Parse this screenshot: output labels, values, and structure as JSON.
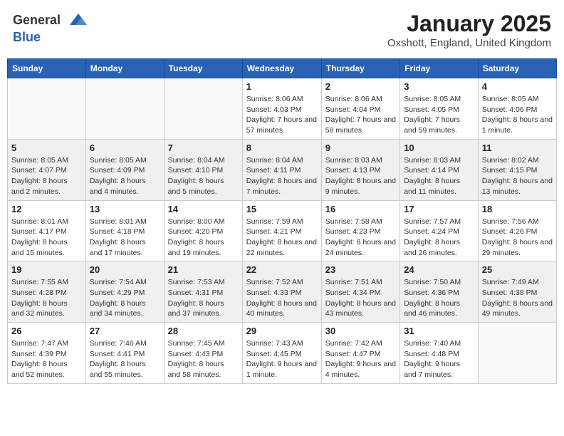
{
  "header": {
    "logo_general": "General",
    "logo_blue": "Blue",
    "month_title": "January 2025",
    "location": "Oxshott, England, United Kingdom"
  },
  "columns": [
    "Sunday",
    "Monday",
    "Tuesday",
    "Wednesday",
    "Thursday",
    "Friday",
    "Saturday"
  ],
  "weeks": [
    [
      {
        "day": "",
        "info": ""
      },
      {
        "day": "",
        "info": ""
      },
      {
        "day": "",
        "info": ""
      },
      {
        "day": "1",
        "info": "Sunrise: 8:06 AM\nSunset: 4:03 PM\nDaylight: 7 hours and 57 minutes."
      },
      {
        "day": "2",
        "info": "Sunrise: 8:06 AM\nSunset: 4:04 PM\nDaylight: 7 hours and 58 minutes."
      },
      {
        "day": "3",
        "info": "Sunrise: 8:05 AM\nSunset: 4:05 PM\nDaylight: 7 hours and 59 minutes."
      },
      {
        "day": "4",
        "info": "Sunrise: 8:05 AM\nSunset: 4:06 PM\nDaylight: 8 hours and 1 minute."
      }
    ],
    [
      {
        "day": "5",
        "info": "Sunrise: 8:05 AM\nSunset: 4:07 PM\nDaylight: 8 hours and 2 minutes."
      },
      {
        "day": "6",
        "info": "Sunrise: 8:05 AM\nSunset: 4:09 PM\nDaylight: 8 hours and 4 minutes."
      },
      {
        "day": "7",
        "info": "Sunrise: 8:04 AM\nSunset: 4:10 PM\nDaylight: 8 hours and 5 minutes."
      },
      {
        "day": "8",
        "info": "Sunrise: 8:04 AM\nSunset: 4:11 PM\nDaylight: 8 hours and 7 minutes."
      },
      {
        "day": "9",
        "info": "Sunrise: 8:03 AM\nSunset: 4:13 PM\nDaylight: 8 hours and 9 minutes."
      },
      {
        "day": "10",
        "info": "Sunrise: 8:03 AM\nSunset: 4:14 PM\nDaylight: 8 hours and 11 minutes."
      },
      {
        "day": "11",
        "info": "Sunrise: 8:02 AM\nSunset: 4:15 PM\nDaylight: 8 hours and 13 minutes."
      }
    ],
    [
      {
        "day": "12",
        "info": "Sunrise: 8:01 AM\nSunset: 4:17 PM\nDaylight: 8 hours and 15 minutes."
      },
      {
        "day": "13",
        "info": "Sunrise: 8:01 AM\nSunset: 4:18 PM\nDaylight: 8 hours and 17 minutes."
      },
      {
        "day": "14",
        "info": "Sunrise: 8:00 AM\nSunset: 4:20 PM\nDaylight: 8 hours and 19 minutes."
      },
      {
        "day": "15",
        "info": "Sunrise: 7:59 AM\nSunset: 4:21 PM\nDaylight: 8 hours and 22 minutes."
      },
      {
        "day": "16",
        "info": "Sunrise: 7:58 AM\nSunset: 4:23 PM\nDaylight: 8 hours and 24 minutes."
      },
      {
        "day": "17",
        "info": "Sunrise: 7:57 AM\nSunset: 4:24 PM\nDaylight: 8 hours and 26 minutes."
      },
      {
        "day": "18",
        "info": "Sunrise: 7:56 AM\nSunset: 4:26 PM\nDaylight: 8 hours and 29 minutes."
      }
    ],
    [
      {
        "day": "19",
        "info": "Sunrise: 7:55 AM\nSunset: 4:28 PM\nDaylight: 8 hours and 32 minutes."
      },
      {
        "day": "20",
        "info": "Sunrise: 7:54 AM\nSunset: 4:29 PM\nDaylight: 8 hours and 34 minutes."
      },
      {
        "day": "21",
        "info": "Sunrise: 7:53 AM\nSunset: 4:31 PM\nDaylight: 8 hours and 37 minutes."
      },
      {
        "day": "22",
        "info": "Sunrise: 7:52 AM\nSunset: 4:33 PM\nDaylight: 8 hours and 40 minutes."
      },
      {
        "day": "23",
        "info": "Sunrise: 7:51 AM\nSunset: 4:34 PM\nDaylight: 8 hours and 43 minutes."
      },
      {
        "day": "24",
        "info": "Sunrise: 7:50 AM\nSunset: 4:36 PM\nDaylight: 8 hours and 46 minutes."
      },
      {
        "day": "25",
        "info": "Sunrise: 7:49 AM\nSunset: 4:38 PM\nDaylight: 8 hours and 49 minutes."
      }
    ],
    [
      {
        "day": "26",
        "info": "Sunrise: 7:47 AM\nSunset: 4:39 PM\nDaylight: 8 hours and 52 minutes."
      },
      {
        "day": "27",
        "info": "Sunrise: 7:46 AM\nSunset: 4:41 PM\nDaylight: 8 hours and 55 minutes."
      },
      {
        "day": "28",
        "info": "Sunrise: 7:45 AM\nSunset: 4:43 PM\nDaylight: 8 hours and 58 minutes."
      },
      {
        "day": "29",
        "info": "Sunrise: 7:43 AM\nSunset: 4:45 PM\nDaylight: 9 hours and 1 minute."
      },
      {
        "day": "30",
        "info": "Sunrise: 7:42 AM\nSunset: 4:47 PM\nDaylight: 9 hours and 4 minutes."
      },
      {
        "day": "31",
        "info": "Sunrise: 7:40 AM\nSunset: 4:48 PM\nDaylight: 9 hours and 7 minutes."
      },
      {
        "day": "",
        "info": ""
      }
    ]
  ]
}
